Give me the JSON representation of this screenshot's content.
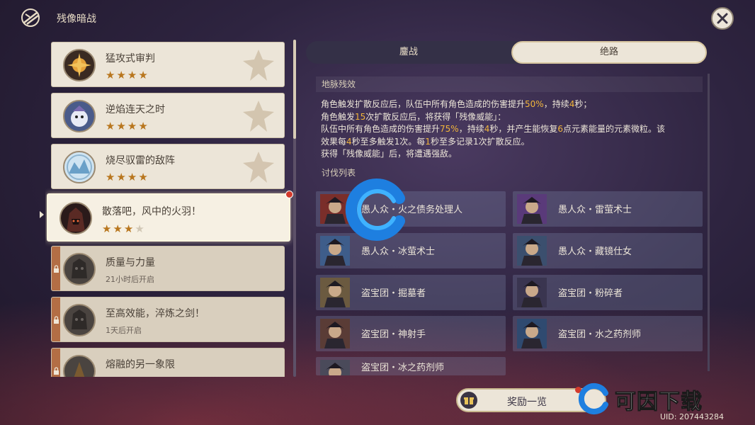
{
  "header": {
    "title": "残像暗战"
  },
  "list": {
    "items": [
      {
        "name": "猛攻式审判",
        "stars": 4,
        "max_stars": 4,
        "locked": false,
        "selected": false,
        "sub": ""
      },
      {
        "name": "逆焰连天之时",
        "stars": 4,
        "max_stars": 4,
        "locked": false,
        "selected": false,
        "sub": ""
      },
      {
        "name": "烧尽驭雷的敌阵",
        "stars": 4,
        "max_stars": 4,
        "locked": false,
        "selected": false,
        "sub": ""
      },
      {
        "name": "散落吧，风中的火羽！",
        "stars": 3,
        "max_stars": 4,
        "locked": false,
        "selected": true,
        "sub": ""
      },
      {
        "name": "质量与力量",
        "stars": 0,
        "max_stars": 0,
        "locked": true,
        "selected": false,
        "sub": "21小时后开启"
      },
      {
        "name": "至高效能，淬炼之剑！",
        "stars": 0,
        "max_stars": 0,
        "locked": true,
        "selected": false,
        "sub": "1天后开启"
      },
      {
        "name": "熔融的另一象限",
        "stars": 0,
        "max_stars": 0,
        "locked": true,
        "selected": false,
        "sub": ""
      }
    ]
  },
  "tabs": [
    {
      "label": "鏖战",
      "active": false
    },
    {
      "label": "绝路",
      "active": true
    }
  ],
  "ley_line": {
    "heading": "地脉残效",
    "lines": [
      [
        {
          "t": "角色触发扩散反应后，队伍中所有角色造成的伤害提升"
        },
        {
          "t": "50%",
          "hl": true
        },
        {
          "t": "，持续"
        },
        {
          "t": "4",
          "hl": true
        },
        {
          "t": "秒；"
        }
      ],
      [
        {
          "t": "角色触发"
        },
        {
          "t": "15",
          "hl": true
        },
        {
          "t": "次扩散反应后，将获得「残像威能」："
        }
      ],
      [
        {
          "t": "队伍中所有角色造成的伤害提升"
        },
        {
          "t": "75%",
          "hl": true
        },
        {
          "t": "，持续"
        },
        {
          "t": "4",
          "hl": true
        },
        {
          "t": "秒，并产生能恢复"
        },
        {
          "t": "6",
          "hl": true
        },
        {
          "t": "点元素能量的元素微粒。该"
        }
      ],
      [
        {
          "t": "效果每"
        },
        {
          "t": "4",
          "hl": true
        },
        {
          "t": "秒至多触发1次。每"
        },
        {
          "t": "1",
          "hl": true
        },
        {
          "t": "秒至多记录1次扩散反应。"
        }
      ],
      [
        {
          "t": "获得「残像威能」后，将遭遇强敌。"
        }
      ]
    ]
  },
  "enemies": {
    "heading": "讨伐列表",
    "items": [
      {
        "name": "愚人众・火之债务处理人",
        "icon": "fatui-pyro-agent-icon",
        "color": "#7a2e2a"
      },
      {
        "name": "愚人众・雷萤术士",
        "icon": "fatui-electro-cicin-mage-icon",
        "color": "#5a3a7a"
      },
      {
        "name": "愚人众・冰萤术士",
        "icon": "fatui-cryo-cicin-mage-icon",
        "color": "#3e5d8a"
      },
      {
        "name": "愚人众・藏镜仕女",
        "icon": "fatui-mirror-maiden-icon",
        "color": "#3b4f6e"
      },
      {
        "name": "盗宝团・掘墓者",
        "icon": "treasure-hoarder-gravedigger-icon",
        "color": "#6b5a40"
      },
      {
        "name": "盗宝团・粉碎者",
        "icon": "treasure-hoarder-crusher-icon",
        "color": "#3a3550"
      },
      {
        "name": "盗宝团・神射手",
        "icon": "treasure-hoarder-marksman-icon",
        "color": "#5a3c36"
      },
      {
        "name": "盗宝团・水之药剂师",
        "icon": "treasure-hoarder-hydro-potioneer-icon",
        "color": "#2f4a70"
      },
      {
        "name": "盗宝团・冰之药剂师",
        "icon": "treasure-hoarder-cryo-potioneer-icon",
        "color": "#4a4a5a"
      }
    ]
  },
  "footer": {
    "reward_label": "奖励一览",
    "watermark": "可因下载",
    "uid": "UID: 207443284"
  }
}
